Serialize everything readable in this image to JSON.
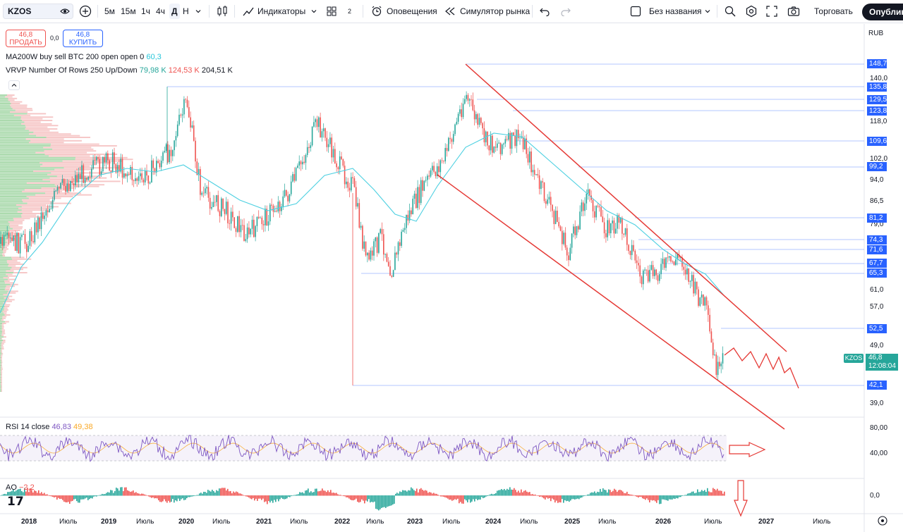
{
  "toolbar": {
    "symbol": "KZOS",
    "intervals": [
      "5м",
      "15м",
      "1ч",
      "4ч",
      "Д",
      "Н"
    ],
    "indicators_label": "Индикаторы",
    "layouts_count": "2",
    "alerts_label": "Оповещения",
    "replay_label": "Симулятор рынка",
    "layout_name": "Без названия",
    "trade_label": "Торговать",
    "publish_label": "Опубликовать"
  },
  "legend": {
    "sell_price": "46,8",
    "sell_label": "ПРОДАТЬ",
    "spread": "0,0",
    "buy_price": "46,8",
    "buy_label": "КУПИТЬ",
    "ma_label": "MA200W buy sell BTC 200 open open 0",
    "ma_value": "60,3",
    "vrvp_label": "VRVP Number Of Rows 250 Up/Down",
    "vrvp_up": "79,98 K",
    "vrvp_down": "124,53 K",
    "vrvp_total": "204,51 K",
    "rsi_label": "RSI 14 close",
    "rsi_value": "46,83",
    "rsi_ma": "49,38",
    "ao_label": "AO",
    "ao_value": "−2,2"
  },
  "currency": "RUB",
  "price_axis_labels": [
    "140,0",
    "118,0",
    "102,0",
    "94,0",
    "86,5",
    "79,0",
    "61,0",
    "57,0",
    "49,0",
    "39,0"
  ],
  "price_tags": [
    "148,7",
    "135,8",
    "129,5",
    "123,8",
    "109,6",
    "99,2",
    "81,2",
    "74,3",
    "71,6",
    "67,7",
    "65,3",
    "52,5",
    "42,1"
  ],
  "current_price": {
    "symbol": "KZOS",
    "price": "46,8",
    "time": "12:08:04"
  },
  "rsi_axis": [
    "80,00",
    "40,00"
  ],
  "ao_axis": [
    "0,0"
  ],
  "x_axis_labels": [
    {
      "text": "2018",
      "bold": true
    },
    {
      "text": "Июль",
      "bold": false
    },
    {
      "text": "2019",
      "bold": true
    },
    {
      "text": "Июль",
      "bold": false
    },
    {
      "text": "2020",
      "bold": true
    },
    {
      "text": "Июль",
      "bold": false
    },
    {
      "text": "2021",
      "bold": true
    },
    {
      "text": "Июль",
      "bold": false
    },
    {
      "text": "2022",
      "bold": true
    },
    {
      "text": "Июль",
      "bold": false
    },
    {
      "text": "2023",
      "bold": true
    },
    {
      "text": "Июль",
      "bold": false
    },
    {
      "text": "2024",
      "bold": true
    },
    {
      "text": "Июль",
      "bold": false
    },
    {
      "text": "2025",
      "bold": true
    },
    {
      "text": "Июль",
      "bold": false
    },
    {
      "text": "2026",
      "bold": true
    },
    {
      "text": "Июль",
      "bold": false
    },
    {
      "text": "2027",
      "bold": true
    },
    {
      "text": "Июль",
      "bold": false
    }
  ],
  "colors": {
    "up": "#26a69a",
    "down": "#ef5350",
    "ma": "#4dd0e1",
    "rsi": "#7e57c2",
    "accent": "#2962ff",
    "drawing": "#e53935"
  }
}
